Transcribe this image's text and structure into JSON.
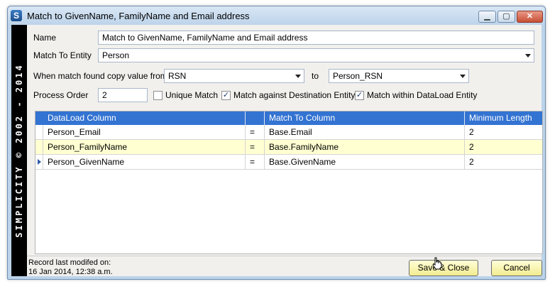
{
  "window": {
    "app_icon": "S",
    "title": "Match to GivenName, FamilyName and Email address",
    "controls": {
      "minimize": "▁",
      "maximize": "▢",
      "close": "✕"
    },
    "sidebar_text": "SIMPLICITY © 2002 - 2014"
  },
  "form": {
    "name_label": "Name",
    "name_value": "Match to GivenName, FamilyName and Email address",
    "entity_label": "Match To Entity",
    "entity_value": "Person",
    "copy_label": "When match found copy value from",
    "copy_from": "RSN",
    "to_label": "to",
    "copy_to": "Person_RSN",
    "order_label": "Process Order",
    "order_value": "2",
    "unique_label": "Unique Match",
    "unique_checked": false,
    "dest_label": "Match against Destination Entity",
    "dest_checked": true,
    "within_label": "Match within DataLoad Entity",
    "within_checked": true
  },
  "grid": {
    "columns": [
      "DataLoad Column",
      "",
      "Match To Column",
      "Minimum Length"
    ],
    "rows": [
      {
        "dataload": "Person_Email",
        "op": "=",
        "match": "Base.Email",
        "min": "2"
      },
      {
        "dataload": "Person_FamilyName",
        "op": "=",
        "match": "Base.FamilyName",
        "min": "2"
      },
      {
        "dataload": "Person_GivenName",
        "op": "=",
        "match": "Base.GivenName",
        "min": "2"
      }
    ]
  },
  "status": {
    "line1": "Record last modifed on:",
    "line2": "16 Jan 2014, 12:38 a.m."
  },
  "buttons": {
    "save": "Save & Close",
    "cancel": "Cancel"
  },
  "colors": {
    "header_blue": "#3373d2",
    "selected_row": "#ffffd2",
    "button_yellow": "#f2ec8f"
  }
}
